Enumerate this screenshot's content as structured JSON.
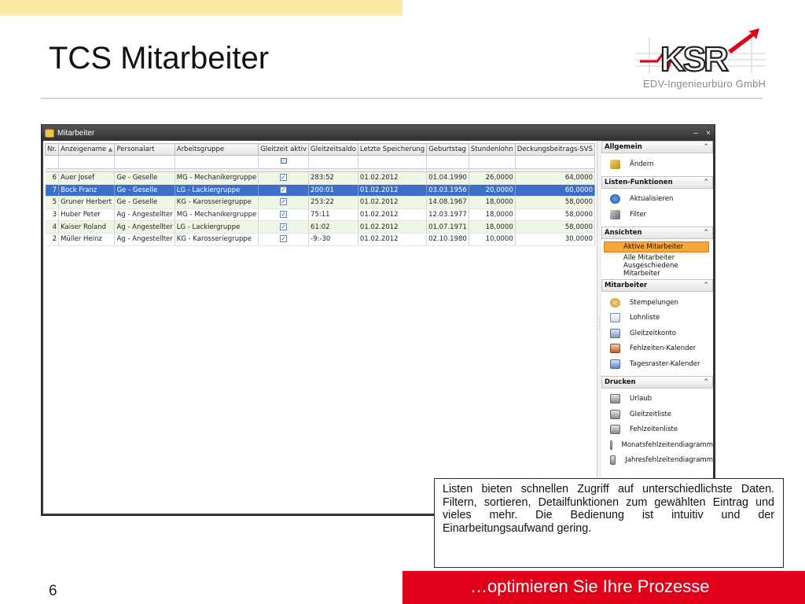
{
  "slide": {
    "title": "TCS Mitarbeiter",
    "page_number": "6",
    "footer_slogan": "…optimieren Sie Ihre Prozesse",
    "logo_text": "KSR",
    "logo_subtitle": "EDV-Ingenieurbüro GmbH"
  },
  "window": {
    "title": "Mitarbeiter",
    "minimize_glyph": "–",
    "close_glyph": "×"
  },
  "grid": {
    "columns": [
      "Nr.",
      "Anzeigename",
      "Personalart",
      "Arbeitsgruppe",
      "Gleitzeit aktiv",
      "Gleitzeitsaldo",
      "Letzte Speicherung",
      "Geburtstag",
      "Stundenlohn",
      "Deckungsbeitrags-SVS"
    ],
    "sorted_column_arrow": "▲",
    "rows": [
      {
        "nr": "6",
        "name": "Auer Josef",
        "personalart": "Ge - Geselle",
        "gruppe": "MG - Mechanikergruppe",
        "aktiv": "✓",
        "saldo": "283:52",
        "speicherung": "01.02.2012",
        "geburtstag": "01.04.1990",
        "lohn": "26,0000",
        "svs": "64,0000"
      },
      {
        "nr": "7",
        "name": "Bock Franz",
        "personalart": "Ge - Geselle",
        "gruppe": "LG - Lackiergruppe",
        "aktiv": "✓",
        "saldo": "200:01",
        "speicherung": "01.02.2012",
        "geburtstag": "03.03.1956",
        "lohn": "20,0000",
        "svs": "60,0000"
      },
      {
        "nr": "5",
        "name": "Gruner Herbert",
        "personalart": "Ge - Geselle",
        "gruppe": "KG - Karosseriegruppe",
        "aktiv": "✓",
        "saldo": "253:22",
        "speicherung": "01.02.2012",
        "geburtstag": "14.08.1967",
        "lohn": "18,0000",
        "svs": "58,0000"
      },
      {
        "nr": "3",
        "name": "Huber Peter",
        "personalart": "Ag - Angestellter",
        "gruppe": "MG - Mechanikergruppe",
        "aktiv": "✓",
        "saldo": "75:11",
        "speicherung": "01.02.2012",
        "geburtstag": "12.03.1977",
        "lohn": "18,0000",
        "svs": "58,0000"
      },
      {
        "nr": "4",
        "name": "Kaiser Roland",
        "personalart": "Ag - Angestellter",
        "gruppe": "LG - Lackiergruppe",
        "aktiv": "✓",
        "saldo": "61:02",
        "speicherung": "01.02.2012",
        "geburtstag": "01.07.1971",
        "lohn": "18,0000",
        "svs": "58,0000"
      },
      {
        "nr": "2",
        "name": "Müller Heinz",
        "personalart": "Ag - Angestellter",
        "gruppe": "KG - Karosseriegruppe",
        "aktiv": "✓",
        "saldo": "-9:-30",
        "speicherung": "01.02.2012",
        "geburtstag": "02.10.1980",
        "lohn": "10,0000",
        "svs": "30,0000"
      }
    ]
  },
  "sidebar": {
    "collapse_glyph": "⌃",
    "allgemein": {
      "header": "Allgemein",
      "items": [
        "Ändern"
      ]
    },
    "listen": {
      "header": "Listen-Funktionen",
      "items": [
        "Aktualisieren",
        "Filter"
      ]
    },
    "ansichten": {
      "header": "Ansichten",
      "items": [
        "Aktive Mitarbeiter",
        "Alle Mitarbeiter",
        "Ausgeschiedene Mitarbeiter"
      ],
      "active_index": 0
    },
    "mitarbeiter": {
      "header": "Mitarbeiter",
      "items": [
        "Stempelungen",
        "Lohnliste",
        "Gleitzeitkonto",
        "Fehlzeiten-Kalender",
        "Tagesraster-Kalender"
      ]
    },
    "drucken": {
      "header": "Drucken",
      "items": [
        "Urlaub",
        "Gleitzeitliste",
        "Fehlzeitenliste",
        "Monatsfehlzeitendiagramm",
        "Jahresfehlzeitendiagramm"
      ]
    }
  },
  "callout": {
    "text": "Listen bieten schnellen Zugriff auf unterschiedlichste Daten. Filtern, sortieren, Detailfunktionen zum gewählten Eintrag und vieles mehr. Die Bedienung ist intuitiv und der Einarbeitungsaufwand gering."
  },
  "colors": {
    "accent_red": "#e1001a",
    "top_bar_yellow": "#fbe9a6",
    "selection_blue": "#3d6fc8",
    "active_view_orange": "#f7a43a",
    "alt_row_green": "#eef7e6"
  },
  "icons": {
    "aendern": "edit-icon",
    "aktualisieren": "refresh-icon",
    "filter": "filter-icon",
    "stempelungen": "stamp-icon",
    "lohnliste": "list-icon",
    "gleitzeitkonto": "account-icon",
    "fehlzeiten": "calendar-icon",
    "tagesraster": "calendar-search-icon",
    "drucken": "printer-icon"
  }
}
